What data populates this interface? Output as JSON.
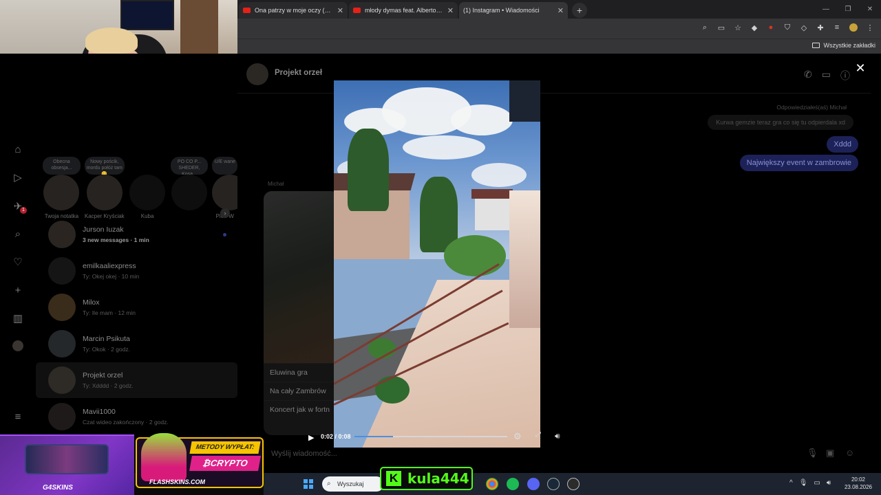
{
  "browser": {
    "tabs": [
      {
        "title": "Ona patrzy w moje oczy (prod...",
        "icon": "youtube-icon",
        "active": false
      },
      {
        "title": "młody dymas feat. Alberto - BA",
        "icon": "youtube-icon",
        "active": false
      },
      {
        "title": "(1) Instagram • Wiadomości",
        "icon": "instagram-icon",
        "active": true
      }
    ],
    "new_tab": "+",
    "bookmarks_folder": "Wszystkie zakładki"
  },
  "instagram": {
    "nav_badge": "1",
    "notes": [
      {
        "text": "Obecna obsesja...",
        "name": "Twoja notatka"
      },
      {
        "text": "Nowy pościk, mordu połóż tam 😊",
        "name": "Kacper Kryściak"
      },
      {
        "text": "",
        "name": "Kuba"
      },
      {
        "text": "PO CO P... SHEDER, Kosa...",
        "name": ""
      },
      {
        "text": "U/E wane",
        "name": "Piotr W"
      }
    ],
    "notes_next": "›",
    "conversations": [
      {
        "name": "Jurson Iuzak",
        "snippet": "3 new messages · 1 min",
        "unread": true
      },
      {
        "name": "emilkaaliexpress",
        "snippet": "Ty: Okej okej · 10 min",
        "unread": false
      },
      {
        "name": "Milox",
        "snippet": "Ty: Ile mam · 12 min",
        "unread": false
      },
      {
        "name": "Marcin Psikuta",
        "snippet": "Ty: Okok · 2 godz.",
        "unread": false
      },
      {
        "name": "Projekt orzel",
        "snippet": "Ty: Xdddd · 2 godz.",
        "unread": false
      },
      {
        "name": "Mavii1000",
        "snippet": "Czat wideo zakończony · 2 godz.",
        "unread": false
      }
    ],
    "chat": {
      "title": "Projekt orzeł",
      "reply_header": "Odpowiedziałeś(aś) Michał",
      "reply_quote": "Kurwa gemzie teraz gra co się tu odpierdala xd",
      "my_messages": [
        "Xddd",
        "Największy event w zambrowie"
      ],
      "sender": "Michał",
      "shared_options": [
        "Eluwina gra",
        "Na cały Zambrów",
        "Koncert jak w fortn"
      ],
      "composer_placeholder": "Wyślij wiadomość..."
    },
    "video": {
      "current_time": "0:02",
      "duration": "0:08",
      "progress": 0.25
    }
  },
  "overlays": {
    "sponsor1": "G4SKINS",
    "sponsor2_heading": "METODY WYPŁAT:",
    "sponsor2_sub": "₿CRYPTO",
    "sponsor2_site": "FLASHSKINS.COM",
    "kick_name": "kula444"
  },
  "taskbar": {
    "search_placeholder": "Wyszukaj",
    "time": "20:02",
    "date": "23.08.2026"
  }
}
